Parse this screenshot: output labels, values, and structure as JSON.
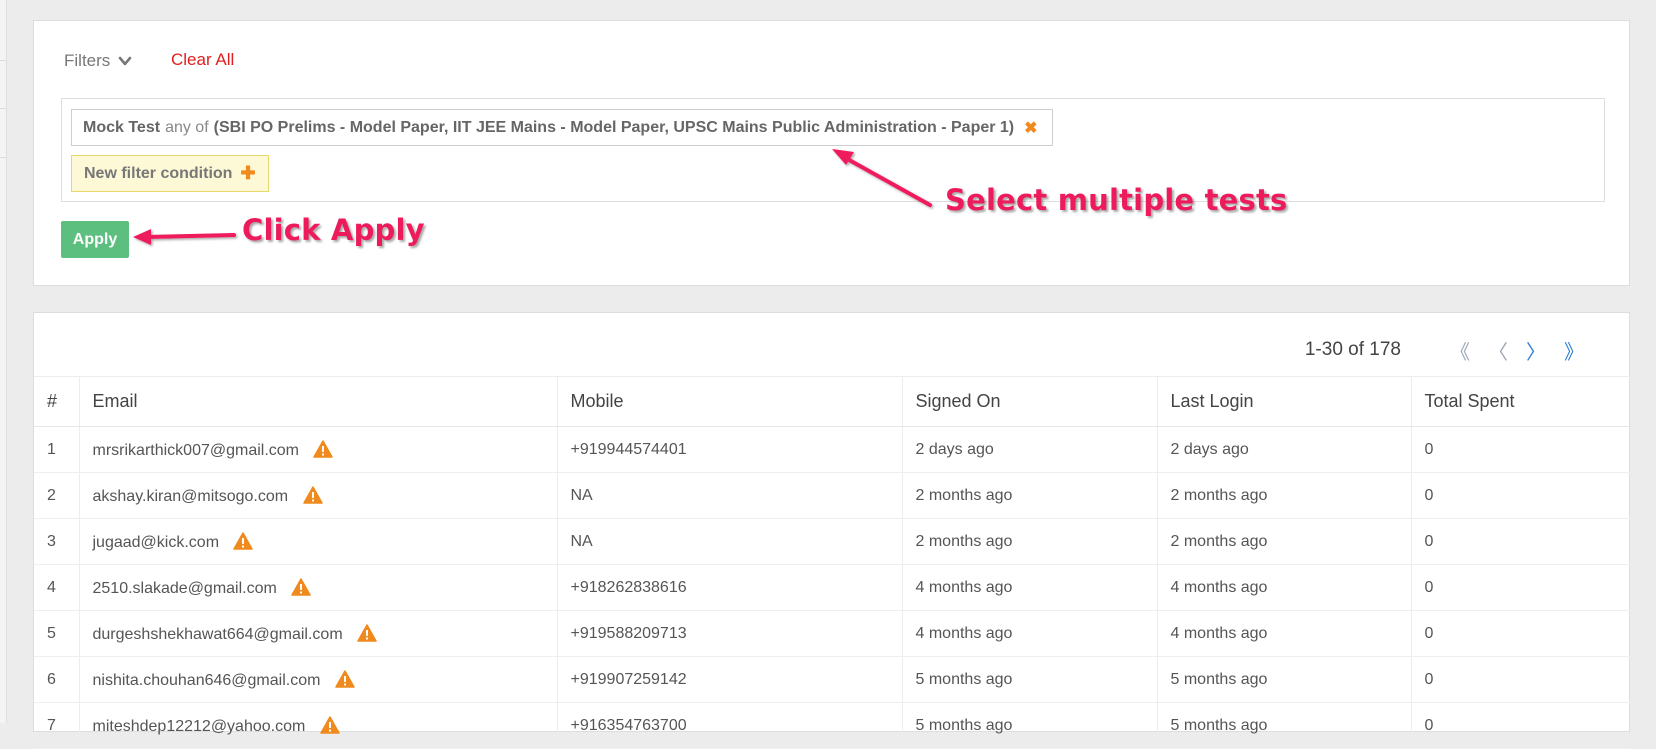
{
  "filters": {
    "toggle_label": "Filters",
    "clear_all": "Clear All",
    "condition": {
      "field": "Mock Test",
      "operator": "any of",
      "values": "(SBI PO Prelims - Model Paper, IIT JEE Mains - Model Paper, UPSC Mains Public Administration - Paper 1)",
      "remove_glyph": "✖"
    },
    "new_condition": "New filter condition",
    "new_condition_glyph": "✚",
    "apply": "Apply"
  },
  "annotations": {
    "click_apply": "Click Apply",
    "select_tests": "Select multiple tests",
    "color": "#ee1b5c"
  },
  "pagination": {
    "range": "1-30 of 178",
    "first": "《",
    "prev": "〈",
    "next": "〉",
    "last": "》"
  },
  "table": {
    "headers": [
      "#",
      "Email",
      "Mobile",
      "Signed On",
      "Last Login",
      "Total Spent"
    ],
    "rows": [
      [
        "1",
        "mrsrikarthick007@gmail.com",
        "+919944574401",
        "2 days ago",
        "2 days ago",
        "0"
      ],
      [
        "2",
        "akshay.kiran@mitsogo.com",
        "NA",
        "2 months ago",
        "2 months ago",
        "0"
      ],
      [
        "3",
        "jugaad@kick.com",
        "NA",
        "2 months ago",
        "2 months ago",
        "0"
      ],
      [
        "4",
        "2510.slakade@gmail.com",
        "+918262838616",
        "4 months ago",
        "4 months ago",
        "0"
      ],
      [
        "5",
        "durgeshshekhawat664@gmail.com",
        "+919588209713",
        "4 months ago",
        "4 months ago",
        "0"
      ],
      [
        "6",
        "nishita.chouhan646@gmail.com",
        "+919907259142",
        "5 months ago",
        "5 months ago",
        "0"
      ],
      [
        "7",
        "miteshdep12212@yahoo.com",
        "+916354763700",
        "5 months ago",
        "5 months ago",
        "0"
      ]
    ],
    "row_icon": "warning-icon"
  },
  "colors": {
    "apply_bg": "#5cbf80",
    "clear_all": "#e02020",
    "new_condition_bg": "#fdf8d6",
    "warning": "#f08a1c",
    "page_active": "#2f7fd4"
  }
}
